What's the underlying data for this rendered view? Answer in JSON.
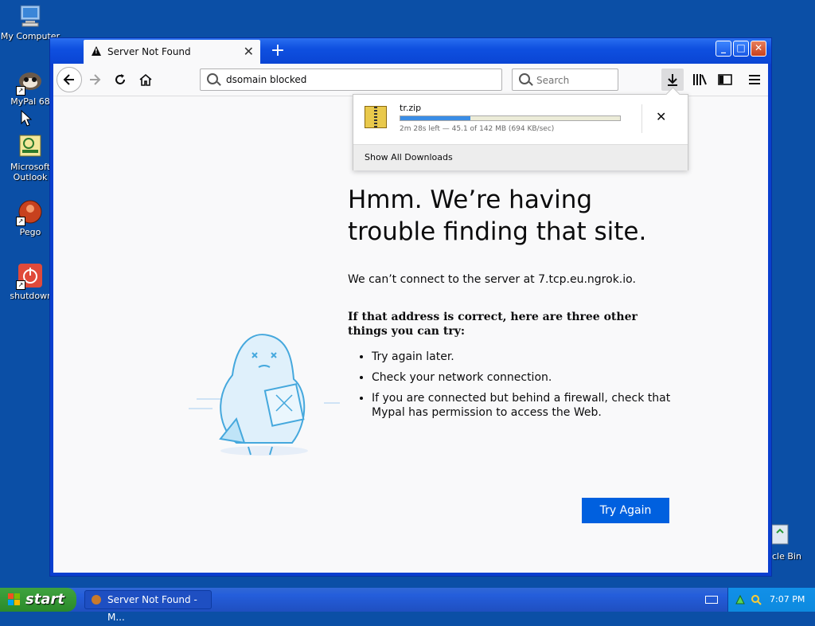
{
  "desktop": {
    "icons": [
      {
        "label": "My Computer",
        "icon": "computer-icon"
      },
      {
        "label": "MyPal 68",
        "icon": "mypal-icon"
      },
      {
        "label": "Microsoft Outlook",
        "icon": "outlook-icon"
      },
      {
        "label": "Pego",
        "icon": "pego-icon"
      },
      {
        "label": "shutdowr",
        "icon": "shutdown-icon"
      }
    ],
    "recycle_label": "cle Bin"
  },
  "browser": {
    "tab_title": "Server Not Found",
    "url": "dsomain blocked",
    "search_placeholder": "Search",
    "window_buttons": {
      "minimize": "_",
      "maximize": "□",
      "close": "✕"
    },
    "new_tab": "+"
  },
  "downloads": {
    "file_name": "tr.zip",
    "progress": 0.32,
    "status": "2m 28s left — 45.1 of 142 MB (694 KB/sec)",
    "cancel": "✕",
    "show_all": "Show All Downloads"
  },
  "error_page": {
    "title": "Hmm. We’re having trouble finding that site.",
    "description": "We can’t connect to the server at 7.tcp.eu.ngrok.io.",
    "heading": "If that address is correct, here are three other things you can try:",
    "suggestions": [
      "Try again later.",
      "Check your network connection.",
      "If you are connected but behind a firewall, check that Mypal has permission to access the Web."
    ],
    "button": "Try Again"
  },
  "taskbar": {
    "start_label": "start",
    "task_label": "Server Not Found - M...",
    "clock": "7:07 PM"
  },
  "colors": {
    "desktop": "#0b4fa6",
    "primary_button": "#0060df",
    "progress_fill": "#3a8de6"
  }
}
